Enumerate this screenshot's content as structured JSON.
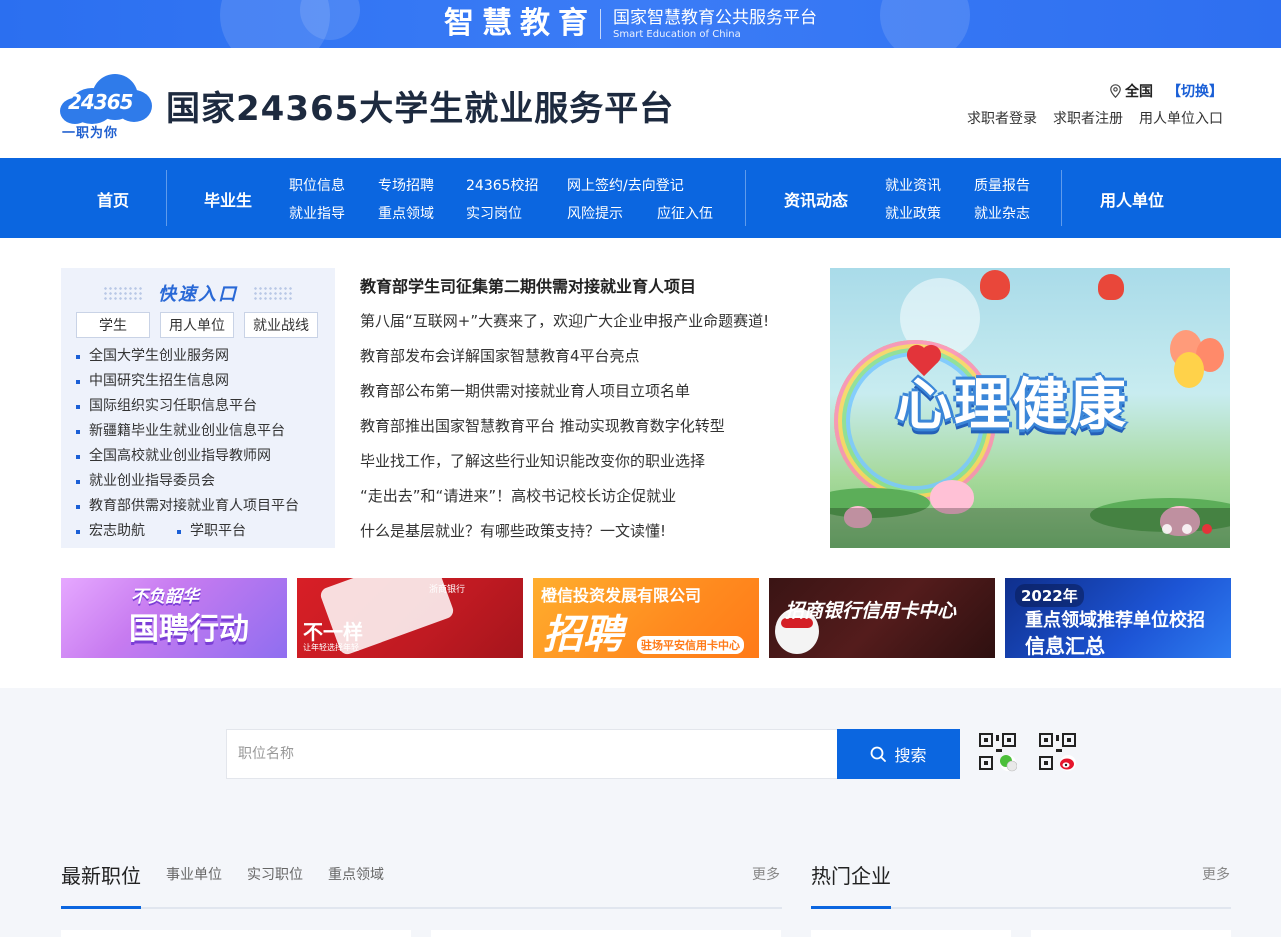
{
  "topbar": {
    "brand_cn": "智慧教育",
    "brand_sub_cn": "国家智慧教育公共服务平台",
    "brand_sub_en": "Smart Education of China"
  },
  "header": {
    "logo_number": "24365",
    "logo_slogan": "一职为你",
    "site_title": "国家24365大学生就业服务平台",
    "region": "全国",
    "switch": "【切换】",
    "user_links": [
      "求职者登录",
      "求职者注册",
      "用人单位入口"
    ]
  },
  "nav": {
    "home": "首页",
    "graduate": "毕业生",
    "graduate_links": [
      [
        "职位信息",
        "专场招聘",
        "24365校招",
        "网上签约/去向登记"
      ],
      [
        "就业指导",
        "重点领域",
        "实习岗位",
        "风险提示",
        "应征入伍"
      ]
    ],
    "news": "资讯动态",
    "news_links": [
      [
        "就业资讯",
        "质量报告"
      ],
      [
        "就业政策",
        "就业杂志"
      ]
    ],
    "employer": "用人单位"
  },
  "quick_entry": {
    "title": "快速入口",
    "tabs": [
      "学生",
      "用人单位",
      "就业战线"
    ],
    "links": [
      "全国大学生创业服务网",
      "中国研究生招生信息网",
      "国际组织实习任职信息平台",
      "新疆籍毕业生就业创业信息平台",
      "全国高校就业创业指导教师网",
      "就业创业指导委员会",
      "教育部供需对接就业育人项目平台"
    ],
    "last_row": [
      "宏志助航",
      "学职平台"
    ]
  },
  "news": {
    "headline": "教育部学生司征集第二期供需对接就业育人项目",
    "items": [
      "第八届“互联网+”大赛来了，欢迎广大企业申报产业命题赛道!",
      "教育部发布会详解国家智慧教育4平台亮点",
      "教育部公布第一期供需对接就业育人项目立项名单",
      "教育部推出国家智慧教育平台 推动实现教育数字化转型",
      "毕业找工作，了解这些行业知识能改变你的职业选择",
      "“走出去”和“请进来”！高校书记校长访企促就业",
      "什么是基层就业？有哪些政策支持？一文读懂!"
    ]
  },
  "carousel": {
    "title": "心理健康",
    "slides": 3,
    "active_index": 2
  },
  "banners": [
    {
      "line1": "不负韶华",
      "line2": "国聘行动"
    },
    {
      "line1": "浙商银行",
      "line2": "不一样",
      "sub": "让年轻选择年轻"
    },
    {
      "line1": "橙信投资发展有限公司",
      "line2": "招聘",
      "sub": "驻场平安信用卡中心"
    },
    {
      "line1": "招商银行信用卡中心"
    },
    {
      "line1": "2022年",
      "line2": "重点领域推荐单位校招",
      "line3": "信息汇总"
    }
  ],
  "search": {
    "placeholder": "职位名称",
    "button": "搜索"
  },
  "sections": {
    "jobs_title": "最新职位",
    "jobs_tabs": [
      "事业单位",
      "实习职位",
      "重点领域"
    ],
    "more": "更多",
    "companies_title": "热门企业"
  }
}
